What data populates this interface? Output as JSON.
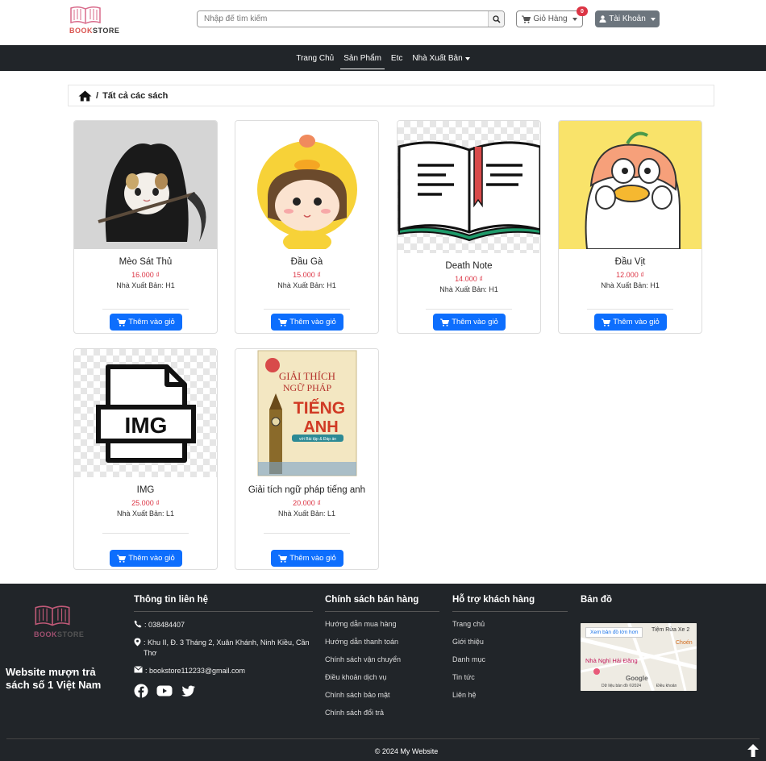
{
  "header": {
    "logo_text_red": "BOOK",
    "logo_text_dark": "STORE",
    "search_placeholder": "Nhập để tìm kiếm",
    "cart_label": "Giỏ Hàng",
    "cart_count": "0",
    "account_label": "Tài Khoản"
  },
  "nav": {
    "items": [
      "Trang Chủ",
      "Sản Phẩm",
      "Etc",
      "Nhà Xuất Bản"
    ],
    "active": "Sản Phẩm"
  },
  "breadcrumb": {
    "separator": "/",
    "label": "Tất cả các sách"
  },
  "products": [
    {
      "title": "Mèo Sát Thủ",
      "price": "16.000 ₫",
      "publisher": "Nhà Xuất Bản: H1",
      "button": "Thêm vào giỏ"
    },
    {
      "title": "Đầu Gà",
      "price": "15.000 ₫",
      "publisher": "Nhà Xuất Bản: H1",
      "button": "Thêm vào giỏ"
    },
    {
      "title": "Death Note",
      "price": "14.000 ₫",
      "publisher": "Nhà Xuất Bản: H1",
      "button": "Thêm vào giỏ"
    },
    {
      "title": "Đầu Vịt",
      "price": "12.000 ₫",
      "publisher": "Nhà Xuất Bản: H1",
      "button": "Thêm vào giỏ"
    },
    {
      "title": "IMG",
      "price": "25.000 ₫",
      "publisher": "Nhà Xuất Bản: L1",
      "button": "Thêm vào giỏ",
      "image_text": "IMG"
    },
    {
      "title": "Giải tích ngữ pháp tiếng anh",
      "price": "20.000 ₫",
      "publisher": "Nhà Xuất Bản: L1",
      "button": "Thêm vào giỏ",
      "cover": {
        "line1": "GIẢI THÍCH",
        "line2": "NGỮ PHÁP",
        "line3": "TIẾNG",
        "line4": "ANH",
        "sub": "với Bài tập & Đáp án"
      }
    }
  ],
  "footer": {
    "slogan": "Website mượn trả sách số 1 Việt Nam",
    "contact": {
      "title": "Thông tin liên hệ",
      "phone": ": 038484407",
      "address": ": Khu II, Đ. 3 Tháng 2, Xuân Khánh, Ninh Kiều, Cần Thơ",
      "email": ": bookstore112233@gmail.com"
    },
    "policy": {
      "title": "Chính sách bán hàng",
      "links": [
        "Hướng dẫn mua hàng",
        "Hướng dẫn thanh toán",
        "Chính sách vận chuyển",
        "Điều khoản dịch vụ",
        "Chính sách bảo mật",
        "Chính sách đổi trả"
      ]
    },
    "support": {
      "title": "Hỗ trợ khách hàng",
      "links": [
        "Trang chủ",
        "Giới thiệu",
        "Danh mục",
        "Tin tức",
        "Liên hệ"
      ]
    },
    "map": {
      "title": "Bản đồ",
      "button": "Xem bản đồ lớn hơn",
      "label1": "Tiệm Rửa Xe 2",
      "label2": "Nhà Nghỉ Hải Đăng",
      "label3": "Choén",
      "brand": "Google",
      "attribution": "Dữ liệu bản đồ ©2024",
      "terms": "Điều khoản"
    },
    "copyright": "© 2024 My Website"
  },
  "colors": {
    "primary": "#0d6efd",
    "dark": "#212529",
    "price": "#dc3545",
    "badge": "#dc3545",
    "account": "#6c757d"
  }
}
